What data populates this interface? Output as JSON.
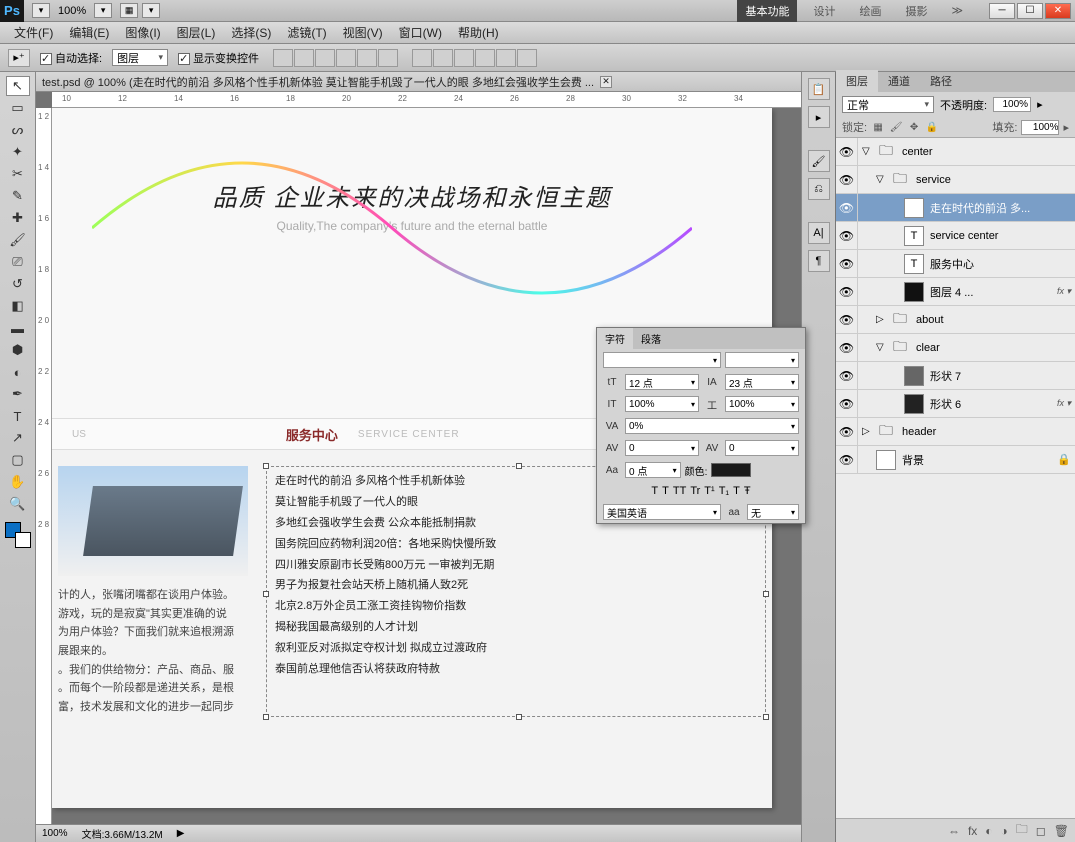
{
  "app": {
    "logo": "Ps",
    "zoom": "100%"
  },
  "workspaces": [
    "基本功能",
    "设计",
    "绘画",
    "摄影"
  ],
  "menu": [
    "文件(F)",
    "编辑(E)",
    "图像(I)",
    "图层(L)",
    "选择(S)",
    "滤镜(T)",
    "视图(V)",
    "窗口(W)",
    "帮助(H)"
  ],
  "options": {
    "auto_select": "自动选择:",
    "group": "图层",
    "show_transform": "显示变换控件"
  },
  "doc_tab": "test.psd @ 100% (走在时代的前沿 多风格个性手机新体验 莫让智能手机毁了一代人的眼 多地红会强收学生会费 ...",
  "ruler_h": [
    "10",
    "12",
    "14",
    "16",
    "18",
    "20",
    "22",
    "24",
    "26",
    "28",
    "30",
    "32",
    "34"
  ],
  "ruler_v": [
    "1 2",
    "1 4",
    "1 6",
    "1 8",
    "2 0",
    "2 2",
    "2 4",
    "2 6",
    "2 8"
  ],
  "hero": {
    "title": "品质 企业未来的决战场和永恒主题",
    "sub": "Quality,The company's future and the eternal battle"
  },
  "service": {
    "zh": "服务中心",
    "en": "SERVICE CENTER",
    "tab_us": "US"
  },
  "desc": [
    "计的人，张嘴闭嘴都在谈用户体验。",
    "游戏，玩的是寂寞\"其实更准确的说",
    "为用户体验？下面我们就来追根溯源",
    "展跟来的。",
    "。我们的供给物分：产品、商品、服",
    "。而每个一阶段都是递进关系，是根",
    "富，技术发展和文化的进步一起同步"
  ],
  "news": [
    "走在时代的前沿 多风格个性手机新体验",
    "莫让智能手机毁了一代人的眼",
    "多地红会强收学生会费 公众本能抵制捐款",
    "国务院回应药物利润20倍：各地采购快慢所致",
    "四川雅安原副市长受贿800万元 一审被判无期",
    "男子为报复社会站天桥上随机捅人致2死",
    "北京2.8万外企员工涨工资挂钩物价指数",
    "揭秘我国最高级别的人才计划",
    "叙利亚反对派拟定夺权计划 拟成立过渡政府",
    "泰国前总理他信否认将获政府特赦"
  ],
  "status": {
    "zoom": "100%",
    "doc": "文档:3.66M/13.2M"
  },
  "char": {
    "tabs": [
      "字符",
      "段落"
    ],
    "size_ico": "tT",
    "size": "12 点",
    "leading_ico": "IA",
    "leading": "23 点",
    "vscale_ico": "IT",
    "vscale": "100%",
    "hscale_ico": "工",
    "hscale": "100%",
    "va_ico": "VA",
    "va": "0%",
    "av_ico": "AV",
    "av": "0",
    "av2_ico": "AV",
    "av2": "0",
    "baseline_ico": "Aa",
    "baseline": "0 点",
    "color_label": "颜色:",
    "styles": [
      "T",
      "T",
      "TT",
      "Tr",
      "T¹",
      "T₁",
      "T",
      "Ŧ"
    ],
    "lang": "美国英语",
    "aa_label": "aa",
    "aa": "无"
  },
  "layers_panel": {
    "tabs": [
      "图层",
      "通道",
      "路径"
    ],
    "blend": "正常",
    "opacity_label": "不透明度:",
    "opacity": "100%",
    "lock_label": "锁定:",
    "fill_label": "填充:",
    "fill": "100%"
  },
  "layers": [
    {
      "ind": 0,
      "disc": "▽",
      "type": "folder",
      "name": "center"
    },
    {
      "ind": 1,
      "disc": "▽",
      "type": "folder",
      "name": "service"
    },
    {
      "ind": 2,
      "disc": "",
      "type": "T",
      "name": "走在时代的前沿 多...",
      "sel": true
    },
    {
      "ind": 2,
      "disc": "",
      "type": "T",
      "name": "service center"
    },
    {
      "ind": 2,
      "disc": "",
      "type": "T",
      "name": "服务中心"
    },
    {
      "ind": 2,
      "disc": "",
      "type": "shape",
      "name": "图层 4 ...",
      "fx": true,
      "bg": "#111"
    },
    {
      "ind": 1,
      "disc": "▷",
      "type": "folder",
      "name": "about"
    },
    {
      "ind": 1,
      "disc": "▽",
      "type": "folder",
      "name": "clear"
    },
    {
      "ind": 2,
      "disc": "",
      "type": "shape",
      "name": "形状 7",
      "bg": "#666"
    },
    {
      "ind": 2,
      "disc": "",
      "type": "shape",
      "name": "形状 6",
      "fx": true,
      "bg": "#222"
    },
    {
      "ind": 0,
      "disc": "▷",
      "type": "folder",
      "name": "header"
    },
    {
      "ind": 0,
      "disc": "",
      "type": "bg",
      "name": "背景",
      "lock": true
    }
  ]
}
